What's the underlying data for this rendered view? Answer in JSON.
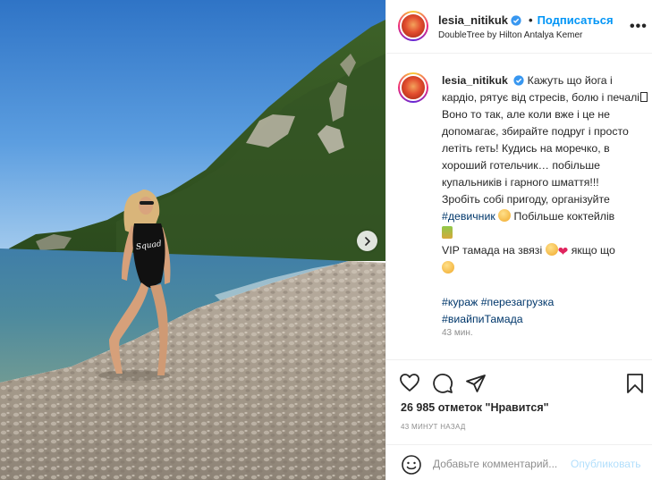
{
  "post": {
    "username": "lesia_nitikuk",
    "follow_label": "Подписаться",
    "dot": "•",
    "location": "DoubleTree by Hilton Antalya Kemer",
    "more": "•••",
    "photo_text": "Squad"
  },
  "caption": {
    "line1": "Кажуть що йога і кардіо, рятує від стресів, болю і печалі",
    "line2": "Воно то так, але коли вже і це не допомагає, збирайте подруг і просто летіть геть! Кудись на моречко, в хороший готельчик… побільше купальників і гарного шмаття!!!",
    "line3": "Зробіть собі пригоду, організуйте",
    "tag_party": "#девичник",
    "line3b": "Побільше коктейлів",
    "line4": "VIP тамада на звязі",
    "line4b": "якщо що",
    "tags": [
      "#кураж",
      "#перезагрузка",
      "#виайпиТамада"
    ],
    "time": "43 мин."
  },
  "actions": {
    "likes_count": "26 985",
    "likes_label": "отметок \"Нравится\"",
    "ago": "43 МИНУТ НАЗАД",
    "comment_placeholder": "Добавьте комментарий...",
    "publish_label": "Опубликовать"
  },
  "icons": {
    "verified": "verified-badge-icon",
    "next": "chevron-right-icon",
    "like": "heart-icon",
    "comment": "comment-icon",
    "share": "share-icon",
    "save": "bookmark-icon",
    "emoji": "smile-icon"
  },
  "colors": {
    "accent": "#0095f6",
    "tag": "#00376b",
    "muted": "#8e8e8e",
    "publish_disabled": "#b2dffc"
  }
}
